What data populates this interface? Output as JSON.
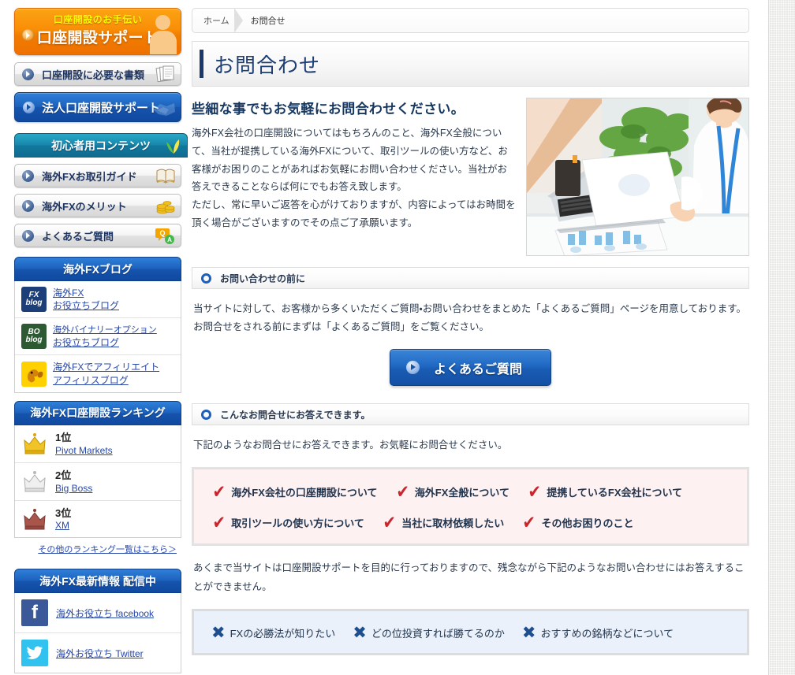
{
  "sidebar": {
    "hero": {
      "sub": "口座開設のお手伝い",
      "main": "口座開設サポート"
    },
    "nav_docs": "口座開設に必要な書類",
    "nav_corporate": "法人口座開設サポート",
    "beginner": {
      "title": "初心者用コンテンツ",
      "items": [
        {
          "label": "海外FXお取引ガイド"
        },
        {
          "label": "海外FXのメリット"
        },
        {
          "label": "よくあるご質問"
        }
      ]
    },
    "blog": {
      "title": "海外FXブログ",
      "items": [
        {
          "badge1": "FX",
          "badge2": "blog",
          "line1": "海外FX",
          "line2": "お役立ちブログ"
        },
        {
          "badge1": "BO",
          "badge2": "blog",
          "line1": "海外バイナリーオプション",
          "line2": "お役立ちブログ"
        },
        {
          "badge1": "",
          "badge2": "",
          "line1": "海外FXでアフィリエイト",
          "line2": "アフィリスブログ"
        }
      ]
    },
    "ranking": {
      "title": "海外FX口座開設ランキング",
      "items": [
        {
          "rank": "1位",
          "name": "Pivot Markets"
        },
        {
          "rank": "2位",
          "name": "Big Boss"
        },
        {
          "rank": "3位",
          "name": "XM"
        }
      ],
      "more_link": "その他のランキング一覧はこちら＞"
    },
    "social": {
      "title": "海外FX最新情報 配信中",
      "items": [
        {
          "label": "海外お役立ち facebook",
          "icon": "facebook-icon"
        },
        {
          "label": "海外お役立ち Twitter",
          "icon": "twitter-icon"
        }
      ]
    }
  },
  "breadcrumb": {
    "home": "ホーム",
    "current": "お問合せ"
  },
  "page_title": "お問合わせ",
  "intro": {
    "heading": "些細な事でもお気軽にお問合わせください。",
    "paragraph1": "海外FX会社の口座開設についてはもちろんのこと、海外FX全般について、当社が提携している海外FXについて、取引ツールの使い方など、お客様がお困りのことがあればお気軽にお問い合わせください。当社がお答えできることならば何にでもお答え致します。",
    "paragraph2": "ただし、常に早いご返答を心がけておりますが、内容によってはお時間を頂く場合がございますのでその点ご了承願います。"
  },
  "section_before": {
    "header": "お問い合わせの前に",
    "body": "当サイトに対して、お客様から多くいただくご質問・お問い合わせをまとめた「よくあるご質問」ページを用意しております。お問合せをされる前にまずは「よくあるご質問」をご覧ください。",
    "cta_label": "よくあるご質問"
  },
  "section_can": {
    "header": "こんなお問合せにお答えできます。",
    "body": "下記のようなお問合せにお答えできます。お気軽にお問合せください。",
    "row1": [
      "海外FX会社の口座開設について",
      "海外FX全般について",
      "提携しているFX会社について"
    ],
    "row2": [
      "取引ツールの使い方について",
      "当社に取材依頼したい",
      "その他お困りのこと"
    ]
  },
  "section_cannot": {
    "body": "あくまで当サイトは口座開設サポートを目的に行っておりますので、残念ながら下記のようなお問い合わせにはお答えすることができません。",
    "row1": [
      "FXの必勝法が知りたい",
      "どの位投資すれば勝てるのか",
      "おすすめの銘柄などについて"
    ]
  },
  "colors": {
    "accent_blue": "#1c5fbd",
    "dark_navy": "#1a3a6b",
    "orange": "#f98e07",
    "check_red": "#c9252c",
    "x_navy": "#1d4e8f"
  }
}
